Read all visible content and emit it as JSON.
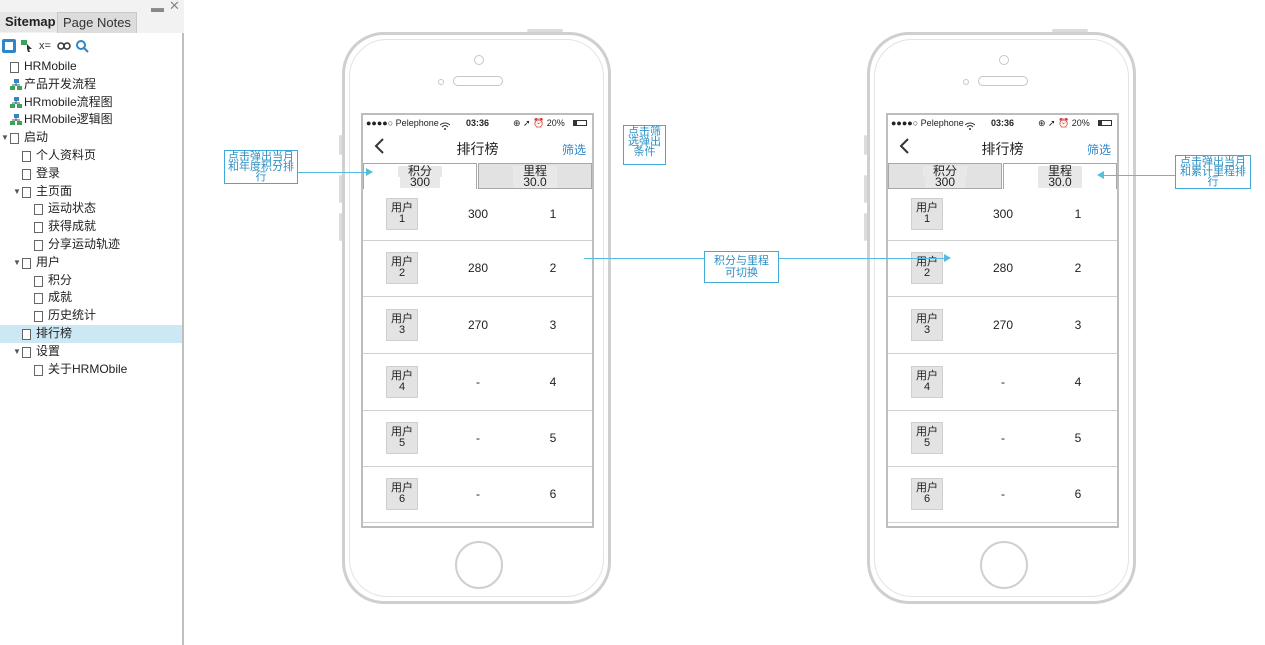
{
  "sidebar": {
    "tab_sitemap": "Sitemap",
    "tab_page_notes": "Page Notes",
    "minimize": "▬",
    "close": "✕",
    "toolbar_icons": [
      "page-view-icon",
      "filter-pointer-icon",
      "variables-icon",
      "link-icon",
      "search-icon"
    ],
    "toolbar_text_variables": "x=",
    "tree": [
      {
        "label": "HRMobile",
        "icon": "page",
        "indent": 0
      },
      {
        "label": "产品开发流程",
        "icon": "flow",
        "indent": 0
      },
      {
        "label": "HRmobile流程图",
        "icon": "flow",
        "indent": 0
      },
      {
        "label": "HRMobile逻辑图",
        "icon": "flow",
        "indent": 0
      },
      {
        "label": "启动",
        "icon": "page",
        "indent": 0,
        "expanded": true
      },
      {
        "label": "个人资料页",
        "icon": "page",
        "indent": 1
      },
      {
        "label": "登录",
        "icon": "page",
        "indent": 1
      },
      {
        "label": "主页面",
        "icon": "page",
        "indent": 1,
        "expanded": true
      },
      {
        "label": "运动状态",
        "icon": "page",
        "indent": 2
      },
      {
        "label": "获得成就",
        "icon": "page",
        "indent": 2
      },
      {
        "label": "分享运动轨迹",
        "icon": "page",
        "indent": 2
      },
      {
        "label": "用户",
        "icon": "page",
        "indent": 1,
        "expanded": true
      },
      {
        "label": "积分",
        "icon": "page",
        "indent": 2
      },
      {
        "label": "成就",
        "icon": "page",
        "indent": 2
      },
      {
        "label": "历史统计",
        "icon": "page",
        "indent": 2
      },
      {
        "label": "排行榜",
        "icon": "page",
        "indent": 1,
        "selected": true
      },
      {
        "label": "设置",
        "icon": "page",
        "indent": 1,
        "expanded": true
      },
      {
        "label": "关于HRMObile",
        "icon": "page",
        "indent": 2
      }
    ]
  },
  "status_bar": {
    "carrier": "●●●●○ Pelephone",
    "wifi": "wifi-icon",
    "time": "03:36",
    "right": "⊕ ➚ ⏰ 20%"
  },
  "phones": [
    {
      "back": "‹",
      "title": "排行榜",
      "filter": "筛选",
      "tabs": [
        {
          "label": "积分",
          "value": "300",
          "active": true
        },
        {
          "label": "里程",
          "value": "30.0",
          "active": false
        }
      ],
      "rows": [
        {
          "user": "用户",
          "num": "1",
          "value": "300",
          "rank": "1"
        },
        {
          "user": "用户",
          "num": "2",
          "value": "280",
          "rank": "2"
        },
        {
          "user": "用户",
          "num": "3",
          "value": "270",
          "rank": "3"
        },
        {
          "user": "用户",
          "num": "4",
          "value": "-",
          "rank": "4"
        },
        {
          "user": "用户",
          "num": "5",
          "value": "-",
          "rank": "5"
        },
        {
          "user": "用户",
          "num": "6",
          "value": "-",
          "rank": "6"
        }
      ]
    },
    {
      "back": "‹",
      "title": "排行榜",
      "filter": "筛选",
      "tabs": [
        {
          "label": "积分",
          "value": "300",
          "active": false
        },
        {
          "label": "里程",
          "value": "30.0",
          "active": true
        }
      ],
      "rows": [
        {
          "user": "用户",
          "num": "1",
          "value": "300",
          "rank": "1"
        },
        {
          "user": "用户",
          "num": "2",
          "value": "280",
          "rank": "2"
        },
        {
          "user": "用户",
          "num": "3",
          "value": "270",
          "rank": "3"
        },
        {
          "user": "用户",
          "num": "4",
          "value": "-",
          "rank": "4"
        },
        {
          "user": "用户",
          "num": "5",
          "value": "-",
          "rank": "5"
        },
        {
          "user": "用户",
          "num": "6",
          "value": "-",
          "rank": "6"
        }
      ]
    }
  ],
  "annotations": {
    "left_note": [
      "点击弹出当月",
      "和年度积分排",
      "行"
    ],
    "filter_note": [
      "点击筛",
      "选弹出",
      "条件"
    ],
    "switch_note": [
      "积分与里程",
      "可切换"
    ],
    "right_note": [
      "点击弹出当月",
      "和累计里程排",
      "行"
    ]
  }
}
